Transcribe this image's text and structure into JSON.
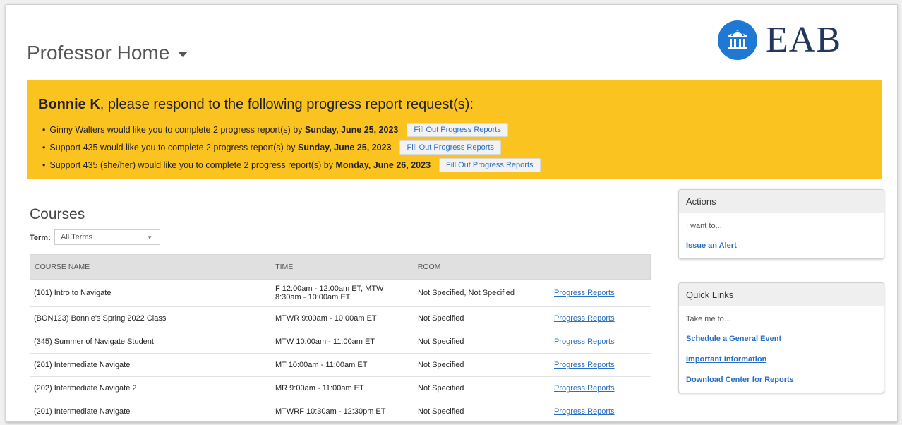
{
  "page": {
    "title": "Professor Home"
  },
  "logo": {
    "text": "EAB",
    "icon": "bank-columns-icon",
    "color": "#1f79d4"
  },
  "banner": {
    "name": "Bonnie K",
    "heading_rest": ", please respond to the following progress report request(s):",
    "color": "#fbc31f",
    "requests": [
      {
        "text": "Ginny Walters would like you to complete 2 progress report(s) by ",
        "date": "Sunday, June 25, 2023",
        "button": "Fill Out Progress Reports"
      },
      {
        "text": "Support 435 would like you to complete 2 progress report(s) by ",
        "date": "Sunday, June 25, 2023",
        "button": "Fill Out Progress Reports"
      },
      {
        "text": "Support 435 (she/her) would like you to complete 2 progress report(s) by ",
        "date": "Monday, June 26, 2023",
        "button": "Fill Out Progress Reports"
      }
    ]
  },
  "courses": {
    "title": "Courses",
    "term_label": "Term:",
    "term_value": "All Terms",
    "headers": [
      "COURSE NAME",
      "TIME",
      "ROOM",
      ""
    ],
    "rows": [
      {
        "name": "(101) Intro to Navigate",
        "time1": "F 12:00am - 12:00am ET, MTW",
        "time2": "8:30am - 10:00am ET",
        "room": "Not Specified, Not Specified",
        "link": "Progress Reports"
      },
      {
        "name": "(BON123) Bonnie's Spring 2022 Class",
        "time1": "MTWR 9:00am - 10:00am ET",
        "time2": "",
        "room": "Not Specified",
        "link": "Progress Reports"
      },
      {
        "name": "(345) Summer of Navigate Student",
        "time1": "MTW 10:00am - 11:00am ET",
        "time2": "",
        "room": "Not Specified",
        "link": "Progress Reports"
      },
      {
        "name": "(201) Intermediate Navigate",
        "time1": "MT 10:00am - 11:00am ET",
        "time2": "",
        "room": "Not Specified",
        "link": "Progress Reports"
      },
      {
        "name": "(202) Intermediate Navigate 2",
        "time1": "MR 9:00am - 11:00am ET",
        "time2": "",
        "room": "Not Specified",
        "link": "Progress Reports"
      },
      {
        "name": "(201) Intermediate Navigate",
        "time1": "MTWRF 10:30am - 12:30pm ET",
        "time2": "",
        "room": "Not Specified",
        "link": "Progress Reports"
      }
    ]
  },
  "actions": {
    "title": "Actions",
    "intro": "I want to...",
    "links": [
      "Issue an Alert"
    ]
  },
  "quick_links": {
    "title": "Quick Links",
    "intro": "Take me to...",
    "links": [
      "Schedule a General Event",
      "Important Information",
      "Download Center for Reports"
    ]
  }
}
